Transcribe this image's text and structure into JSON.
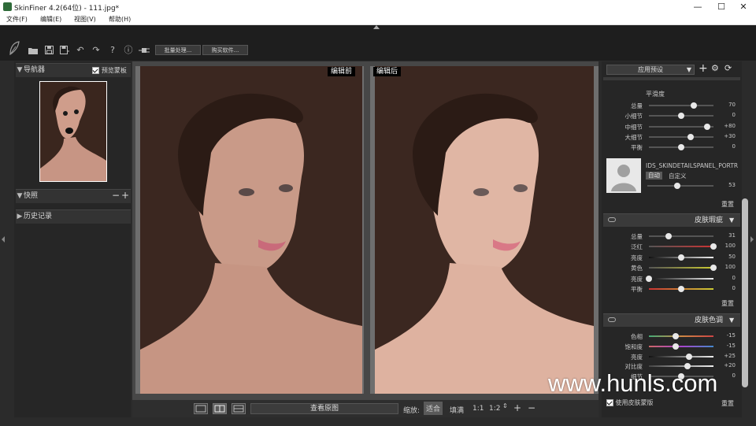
{
  "window": {
    "title": "SkinFiner 4.2(64位) - 111.jpg*",
    "minimize": "—",
    "maximize": "☐",
    "close": "✕"
  },
  "menu": [
    "文件(F)",
    "编辑(E)",
    "视图(V)",
    "帮助(H)"
  ],
  "toolbar": {
    "batch_label": "批量处理...",
    "buy_label": "购买软件..."
  },
  "left": {
    "navigator_label": "导航器",
    "preview_mask_label": "预览蒙板",
    "snapshots_label": "快照",
    "snapshots_minus": "−",
    "snapshots_plus": "+",
    "history_label": "历史记录"
  },
  "canvas": {
    "before_label": "编辑前",
    "after_label": "编辑后"
  },
  "bottom": {
    "view_original": "查看原图",
    "zoom_label": "缩放:",
    "fit": "适合",
    "fill": "填满",
    "ratio_1_1": "1:1",
    "ratio_1_2": "1:2",
    "zoom_in": "+",
    "zoom_out": "−"
  },
  "right": {
    "preset_label": "应用预设",
    "smooth_title": "平滑度",
    "smooth_sliders": [
      {
        "label": "总量",
        "value": "70",
        "level": 0.7
      },
      {
        "label": "小细节",
        "value": "0",
        "level": 0.5
      },
      {
        "label": "中细节",
        "value": "+80",
        "level": 0.9
      },
      {
        "label": "大细节",
        "value": "+30",
        "level": 0.65
      },
      {
        "label": "平衡",
        "value": "0",
        "level": 0.5
      }
    ],
    "portrait_id": "IDS_SKINDETAILSPANEL_PORTR",
    "auto_label": "自动",
    "custom_label": "自定义",
    "portrait_value": "53",
    "portrait_level": 0.45,
    "reset_label": "重置",
    "blemish_title": "皮肤瑕疵",
    "blemish_sliders": [
      {
        "label": "总量",
        "value": "31",
        "level": 0.31
      },
      {
        "label": "泛红",
        "value": "100",
        "level": 1.0
      },
      {
        "label": "亮度",
        "value": "50",
        "level": 0.5
      },
      {
        "label": "黄色",
        "value": "100",
        "level": 1.0
      },
      {
        "label": "亮度",
        "value": "0",
        "level": 0.0
      },
      {
        "label": "平衡",
        "value": "0",
        "level": 0.5
      }
    ],
    "blemish_reset": "重置",
    "tone_title": "皮肤色调",
    "tone_sliders": [
      {
        "label": "色相",
        "value": "-15",
        "level": 0.42
      },
      {
        "label": "饱和度",
        "value": "-15",
        "level": 0.42
      },
      {
        "label": "亮度",
        "value": "+25",
        "level": 0.62
      },
      {
        "label": "对比度",
        "value": "+20",
        "level": 0.6
      },
      {
        "label": "细节",
        "value": "0",
        "level": 0.5
      }
    ],
    "use_skin_mask": "使用皮肤蒙版",
    "tone_reset": "重置"
  },
  "watermark": "www.hunls.com",
  "colors": {
    "background": "#2b2b2b",
    "panel": "#262626",
    "header": "#3a3a3a",
    "photo_bg": "#3b2720"
  }
}
